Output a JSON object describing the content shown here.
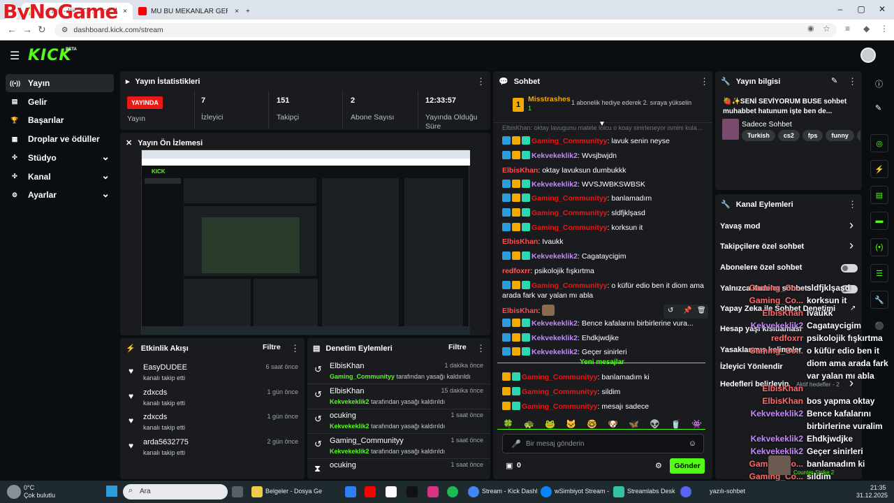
{
  "browser": {
    "tab1_title": "Stream - Kick Dashboard",
    "tab2_title": "MU BU MEKANLAR GERÇEKTEN",
    "url": "dashboard.kick.com/stream",
    "watermark": "ByNoGame"
  },
  "kick": {
    "logo": "KICK",
    "beta": "BETA"
  },
  "sidebar": {
    "items": [
      {
        "label": "Yayın",
        "icon": "broadcast-icon"
      },
      {
        "label": "Gelir",
        "icon": "revenue-icon"
      },
      {
        "label": "Başarılar",
        "icon": "trophy-icon"
      },
      {
        "label": "Droplar ve ödüller",
        "icon": "drops-icon"
      },
      {
        "label": "Stüdyo",
        "icon": "studio-icon"
      },
      {
        "label": "Kanal",
        "icon": "channel-icon"
      },
      {
        "label": "Ayarlar",
        "icon": "settings-icon"
      }
    ]
  },
  "stats": {
    "title": "Yayın İstatistikleri",
    "live_badge": "YAYINDA",
    "live_label": "Yayın",
    "viewers": "7",
    "viewers_label": "İzleyici",
    "followers": "151",
    "followers_label": "Takipçi",
    "subs": "2",
    "subs_label": "Abone Sayısı",
    "duration": "12:33:57",
    "duration_label": "Yayında Olduğu Süre"
  },
  "preview": {
    "title": "Yayın Ön İzlemesi"
  },
  "activity": {
    "title": "Etkinlik Akışı",
    "filter": "Filtre",
    "items": [
      {
        "name": "EasyDUDEE",
        "sub": "kanalı takip etti",
        "time": "6 saat önce"
      },
      {
        "name": "zdxcds",
        "sub": "kanalı takip etti",
        "time": "1 gün önce"
      },
      {
        "name": "zdxcds",
        "sub": "kanalı takip etti",
        "time": "1 gün önce"
      },
      {
        "name": "arda5632775",
        "sub": "kanalı takip etti",
        "time": "2 gün önce"
      }
    ]
  },
  "modlog": {
    "title": "Denetim Eylemleri",
    "filter": "Filtre",
    "items": [
      {
        "name": "ElbisKhan",
        "who": "Gaming_Communityy",
        "rest": " tarafından yasağı kaldırıldı",
        "time": "1 dakika önce"
      },
      {
        "name": "ElbisKhan",
        "who": "Kekvekeklik2",
        "rest": " tarafından yasağı kaldırıldı",
        "time": "15 dakika önce"
      },
      {
        "name": "ocuking",
        "who": "Kekvekeklik2",
        "rest": " tarafından yasağı kaldırıldı",
        "time": "1 saat önce"
      },
      {
        "name": "Gaming_Communityy",
        "who": "Kekvekeklik2",
        "rest": " tarafından yasağı kaldırıldı",
        "time": "1 saat önce"
      },
      {
        "name": "ocuking",
        "who": "",
        "rest": "",
        "time": "1 saat önce"
      }
    ]
  },
  "chat": {
    "title": "Sohbet",
    "pinned_user": "Misstrashes",
    "pinned_count": "1",
    "pinned_msg": "1 abonelik hediye ederek 2. sıraya yükselin",
    "faded_line": "ElbisKhan: oktay lavugunu matele lolcu o koay sinirleneyor ismini kula...",
    "messages": [
      {
        "user": "Gaming_Communityy",
        "text": "lavuk senin neyse",
        "badges": 3,
        "cls": "ug"
      },
      {
        "user": "Kekvekeklik2",
        "text": "Wvsjbwjdn",
        "badges": 3,
        "cls": "uk"
      },
      {
        "user": "ElbisKhan",
        "text": "oktay lavuksun dumbukkk",
        "badges": 0,
        "cls": "ue"
      },
      {
        "user": "Kekvekeklik2",
        "text": "WVSJWBKSWBSK",
        "badges": 3,
        "cls": "uk"
      },
      {
        "user": "Gaming_Communityy",
        "text": "banlamadım",
        "badges": 3,
        "cls": "ug"
      },
      {
        "user": "Gaming_Communityy",
        "text": "sldfjklşasd",
        "badges": 3,
        "cls": "ug"
      },
      {
        "user": "Gaming_Communityy",
        "text": "korksun it",
        "badges": 3,
        "cls": "ug"
      },
      {
        "user": "ElbisKhan",
        "text": "Ivaukk",
        "badges": 0,
        "cls": "ue"
      },
      {
        "user": "Kekvekeklik2",
        "text": "Cagataycigim",
        "badges": 3,
        "cls": "uk"
      },
      {
        "user": "redfoxrr",
        "text": "psikolojik fışkırtma",
        "badges": 0,
        "cls": "ur"
      },
      {
        "user": "Gaming_Communityy",
        "text": "o küfür edio ben it diom ama arada fark var yalan mı abla",
        "badges": 3,
        "cls": "ug"
      },
      {
        "user": "ElbisKhan",
        "text": "",
        "badges": 0,
        "cls": "ue"
      },
      {
        "user": "Kekvekeklik2",
        "text": "Bence kafalarını birbirlerine vura...",
        "badges": 3,
        "cls": "uk"
      },
      {
        "user": "Kekvekeklik2",
        "text": "Ehdkjwdjke",
        "badges": 3,
        "cls": "uk"
      },
      {
        "user": "Kekvekeklik2",
        "text": "Geçer sinirleri",
        "badges": 3,
        "cls": "uk"
      }
    ],
    "new_messages": "Yeni mesajlar",
    "new": [
      {
        "user": "Gaming_Communityy",
        "text": "banlamadım ki"
      },
      {
        "user": "Gaming_Communityy",
        "text": "sildim"
      },
      {
        "user": "Gaming_Communityy",
        "text": "mesajı sadece"
      }
    ],
    "placeholder": "Bir mesaj gönderin",
    "points": "0",
    "send": "Gönder"
  },
  "info": {
    "title": "Yayın bilgisi",
    "stream_title": "🍓✨SENİ SEVİYORUM BUSE sohbet muhabbet hatunum işte ben de...",
    "category": "Sadece Sohbet",
    "tags": [
      "Turkish",
      "cs2",
      "fps",
      "funny",
      "gam"
    ]
  },
  "actions": {
    "title": "Kanal Eylemleri",
    "items": [
      "Yavaş mod",
      "Takipçilere özel sohbet",
      "Abonelere özel sohbet",
      "Yalnızca ifadeler sohbet",
      "Yapay Zeka ile Sohbet Denetimi",
      "Hesap yaşı kısıtlaması",
      "Yasaklanmış kelimeler",
      "İzleyici Yönlendir",
      "Hedefleri belirleyin"
    ],
    "goal_status": "Aktif hedefler - 2"
  },
  "overlay": {
    "lines": [
      {
        "u": "Gaming_Co...",
        "t": "sldfjklşasd"
      },
      {
        "u": "Gaming_Co...",
        "t": "korksun it"
      },
      {
        "u": "ElbisKhan",
        "t": "Ivaukk"
      },
      {
        "u": "Kekvekeklik2",
        "t": "Cagataycigim"
      },
      {
        "u": "redfoxrr",
        "t": "psikolojik fışkırtma"
      },
      {
        "u": "Gaming_Co...",
        "t": "o küfür edio ben it"
      },
      {
        "u": "",
        "t": "diom ama arada fark"
      },
      {
        "u": "",
        "t": "var yalan mı abla"
      },
      {
        "u": "ElbisKhan",
        "t": ""
      },
      {
        "u": "ElbisKhan",
        "t": "bos yapma oktay"
      },
      {
        "u": "Kekvekeklik2",
        "t": "Bence kafalarını"
      },
      {
        "u": "",
        "t": "birbirlerine vuralim"
      },
      {
        "u": "Kekvekeklik2",
        "t": "Ehdkjwdjke"
      },
      {
        "u": "Kekvekeklik2",
        "t": "Geçer sinirleri"
      },
      {
        "u": "Gaming_Co...",
        "t": "banlamadım ki"
      },
      {
        "u": "Gaming_Co...",
        "t": "sildim"
      },
      {
        "u": "Gaming_Co...",
        "t": "mesajı sadece"
      }
    ],
    "game": "Counter-Strike 2"
  },
  "taskbar": {
    "weather_temp": "0°C",
    "weather_desc": "Çok bulutlu",
    "search": "Ara",
    "apps": [
      "Belgeler - Dosya Ge",
      "Stream - Kick Dashl",
      "wSimbiyot Stream -",
      "Streamlabs Desk",
      "yazılı-sohbet"
    ],
    "time": "21:35",
    "date": "31.12.2025"
  }
}
